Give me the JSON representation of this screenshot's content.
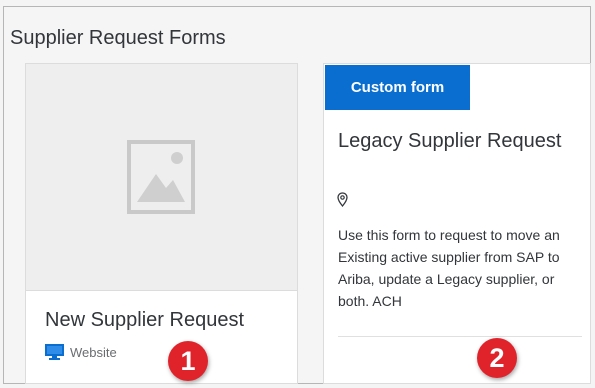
{
  "page": {
    "title": "Supplier Request Forms"
  },
  "cards": [
    {
      "title": "New Supplier Request",
      "category": "Website",
      "image_icon": "image-placeholder-icon",
      "category_icon": "monitor-icon"
    },
    {
      "badge": "Custom form",
      "title": "Legacy Supplier Request",
      "location_icon": "location-pin-icon",
      "description": "Use this form to request to move an Existing active supplier from SAP to Ariba, update a Legacy supplier, or both. ACH"
    }
  ],
  "callouts": {
    "one": "1",
    "two": "2"
  },
  "colors": {
    "accent": "#0a6ed1",
    "callout": "#e0232b"
  }
}
